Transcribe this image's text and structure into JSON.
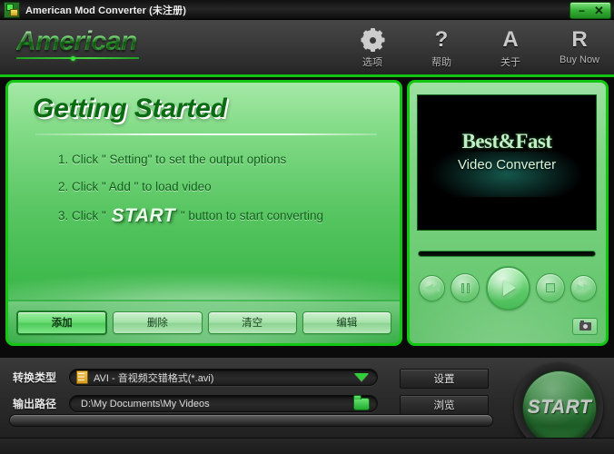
{
  "window": {
    "title": "American Mod Converter (未注册)",
    "icon": "app-icon",
    "minimize_label": "−",
    "close_label": "✕"
  },
  "header": {
    "logo": "American",
    "toolbar": [
      {
        "icon": "gear-icon",
        "glyph": "",
        "label": "选项"
      },
      {
        "icon": "help-icon",
        "glyph": "?",
        "label": "帮助"
      },
      {
        "icon": "about-icon",
        "glyph": "A",
        "label": "关于"
      },
      {
        "icon": "register-icon",
        "glyph": "R",
        "label": "Buy Now"
      }
    ]
  },
  "getting_started": {
    "title": "Getting Started",
    "steps": [
      {
        "prefix": "1. Click \" Setting\" to set the output options",
        "emphasis": "",
        "suffix": ""
      },
      {
        "prefix": "2. Click \" Add \" to load video",
        "emphasis": "",
        "suffix": ""
      },
      {
        "prefix": "3. Click \" ",
        "emphasis": "START",
        "suffix": " \" button to start converting"
      }
    ]
  },
  "file_buttons": [
    {
      "label": "添加",
      "active": true
    },
    {
      "label": "删除",
      "active": false
    },
    {
      "label": "清空",
      "active": false
    },
    {
      "label": "编辑",
      "active": false
    }
  ],
  "preview": {
    "video_title": "Best&Fast",
    "video_subtitle": "Video Converter",
    "controls": [
      {
        "name": "rewind-button",
        "glyph": "◀◀"
      },
      {
        "name": "pause-button",
        "glyph": "❙❙"
      },
      {
        "name": "play-button",
        "glyph": "▶"
      },
      {
        "name": "stop-button",
        "glyph": "■"
      },
      {
        "name": "forward-button",
        "glyph": "▶▶"
      }
    ],
    "snapshot": "camera-icon"
  },
  "settings": {
    "type_label": "转换类型",
    "type_value": "AVI - 音视频交错格式(*.avi)",
    "path_label": "输出路径",
    "path_value": "D:\\My Documents\\My Videos",
    "settings_button": "设置",
    "browse_button": "浏览"
  },
  "start": {
    "label": "START"
  },
  "colors": {
    "accent_green": "#12c712",
    "panel_green": "#59c663",
    "header_dark": "#3b3b3b",
    "title_text": "#f0f0f0"
  }
}
